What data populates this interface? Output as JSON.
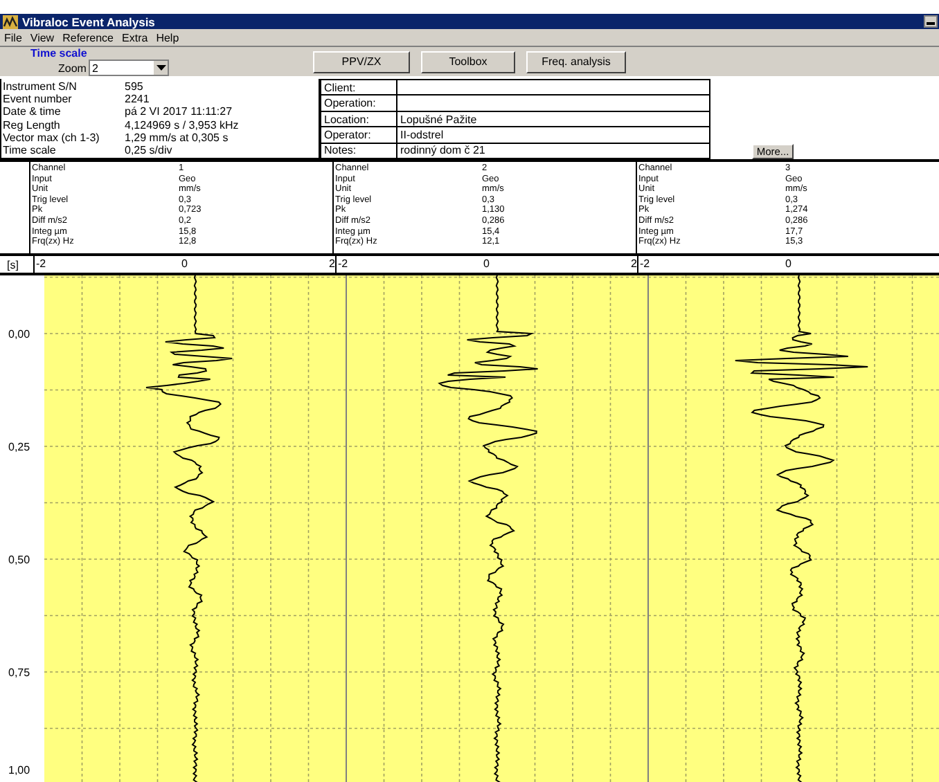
{
  "window": {
    "title": "Vibraloc Event Analysis"
  },
  "menu": [
    "File",
    "View",
    "Reference",
    "Extra",
    "Help"
  ],
  "toolbar": {
    "time_scale_label": "Time scale",
    "zoom_label": "Zoom",
    "zoom_value": "2",
    "buttons": [
      "PPV/ZX",
      "Toolbox",
      "Freq. analysis"
    ]
  },
  "info": [
    {
      "label": "Instrument S/N",
      "value": "595"
    },
    {
      "label": "Event number",
      "value": "2241"
    },
    {
      "label": "Date & time",
      "value": "pá 2 VI 2017 11:11:27"
    },
    {
      "label": "Reg Length",
      "value": "4,124969 s / 3,953 kHz"
    },
    {
      "label": "Vector max (ch 1-3)",
      "value": "1,29 mm/s at 0,305 s"
    },
    {
      "label": "Time scale",
      "value": "0,25 s/div"
    }
  ],
  "details": [
    {
      "label": "Client:"
    },
    {
      "label": "Operation:"
    },
    {
      "label": "Location:",
      "value": "Lopušné Pažite"
    },
    {
      "label": "Operator:",
      "value": "II-odstrel"
    },
    {
      "label": "Notes:",
      "value": "rodinný dom č 21"
    }
  ],
  "more_button": "More...",
  "channels": [
    {
      "fields": [
        {
          "label": "Channel",
          "value": "1"
        },
        {
          "label": "Input",
          "value": "Geo"
        },
        {
          "label": "Unit",
          "value": "mm/s"
        },
        {
          "label": "Trig level",
          "value": "0,3"
        },
        {
          "label": "Pk",
          "value": "0,723"
        },
        {
          "label": "Diff m/s2",
          "value": "0,2"
        },
        {
          "label": "Integ µm",
          "value": "15,8"
        },
        {
          "label": "Frq(zx) Hz",
          "value": "12,8"
        }
      ],
      "x_labels": [
        "-2",
        "0",
        "2"
      ]
    },
    {
      "fields": [
        {
          "label": "Channel",
          "value": "2"
        },
        {
          "label": "Input",
          "value": "Geo"
        },
        {
          "label": "Unit",
          "value": "mm/s"
        },
        {
          "label": "Trig level",
          "value": "0,3"
        },
        {
          "label": "Pk",
          "value": "1,130"
        },
        {
          "label": "Diff m/s2",
          "value": "0,286"
        },
        {
          "label": "Integ µm",
          "value": "15,4"
        },
        {
          "label": "Frq(zx) Hz",
          "value": "12,1"
        }
      ],
      "x_labels": [
        "-2",
        "0",
        "2"
      ]
    },
    {
      "fields": [
        {
          "label": "Channel",
          "value": "3"
        },
        {
          "label": "Input",
          "value": "Geo"
        },
        {
          "label": "Unit",
          "value": "mm/s"
        },
        {
          "label": "Trig level",
          "value": "0,3"
        },
        {
          "label": "Pk",
          "value": "1,274"
        },
        {
          "label": "Diff m/s2",
          "value": "0,286"
        },
        {
          "label": "Integ µm",
          "value": "17,7"
        },
        {
          "label": "Frq(zx) Hz",
          "value": "15,3"
        }
      ],
      "x_labels": [
        "-2",
        "0"
      ]
    }
  ],
  "time_unit": "[s]",
  "y_labels": [
    "0,00",
    "0,25",
    "0,50",
    "0,75",
    "1,00"
  ]
}
